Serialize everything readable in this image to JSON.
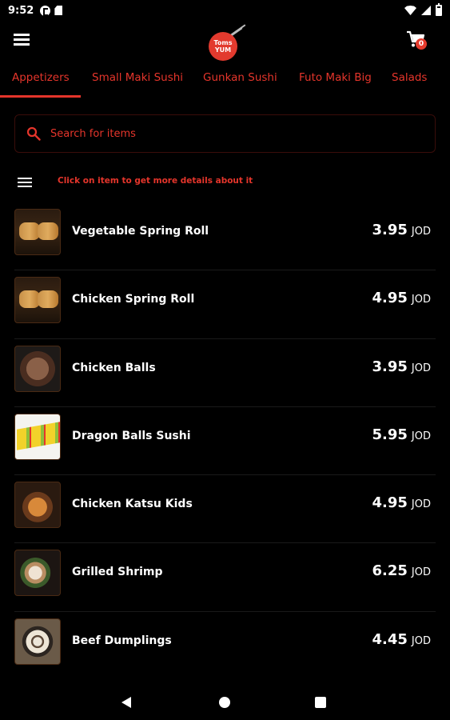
{
  "status_bar": {
    "time": "9:52",
    "icons": [
      "notification-icon",
      "sdcard-icon",
      "wifi-icon",
      "cellular-icon",
      "battery-icon"
    ]
  },
  "app_bar": {
    "logo_line1": "Toms",
    "logo_line2": "YUM",
    "menu_icon": "hamburger-menu-icon",
    "cart_icon": "shopping-cart-icon",
    "cart_badge": "0"
  },
  "tabs": [
    {
      "label": "Appetizers",
      "active": true
    },
    {
      "label": "Small Maki Sushi",
      "active": false
    },
    {
      "label": "Gunkan Sushi",
      "active": false
    },
    {
      "label": "Futo Maki Big",
      "active": false
    },
    {
      "label": "Salads",
      "active": false
    }
  ],
  "search": {
    "placeholder": "Search for items",
    "value": ""
  },
  "hint": {
    "icon": "list-view-icon",
    "text": "Click on item to get more details about it"
  },
  "items": [
    {
      "name": "Vegetable Spring Roll",
      "price": "3.95",
      "currency": "JOD"
    },
    {
      "name": "Chicken Spring Roll",
      "price": "4.95",
      "currency": "JOD"
    },
    {
      "name": "Chicken Balls",
      "price": "3.95",
      "currency": "JOD"
    },
    {
      "name": "Dragon Balls Sushi",
      "price": "5.95",
      "currency": "JOD"
    },
    {
      "name": "Chicken Katsu Kids",
      "price": "4.95",
      "currency": "JOD"
    },
    {
      "name": "Grilled Shrimp",
      "price": "6.25",
      "currency": "JOD"
    },
    {
      "name": "Beef Dumplings",
      "price": "4.45",
      "currency": "JOD"
    }
  ],
  "colors": {
    "accent": "#e5352b",
    "background": "#000000",
    "text": "#ffffff"
  },
  "nav_bar": {
    "icons": [
      "back-icon",
      "home-icon",
      "recents-icon"
    ]
  }
}
